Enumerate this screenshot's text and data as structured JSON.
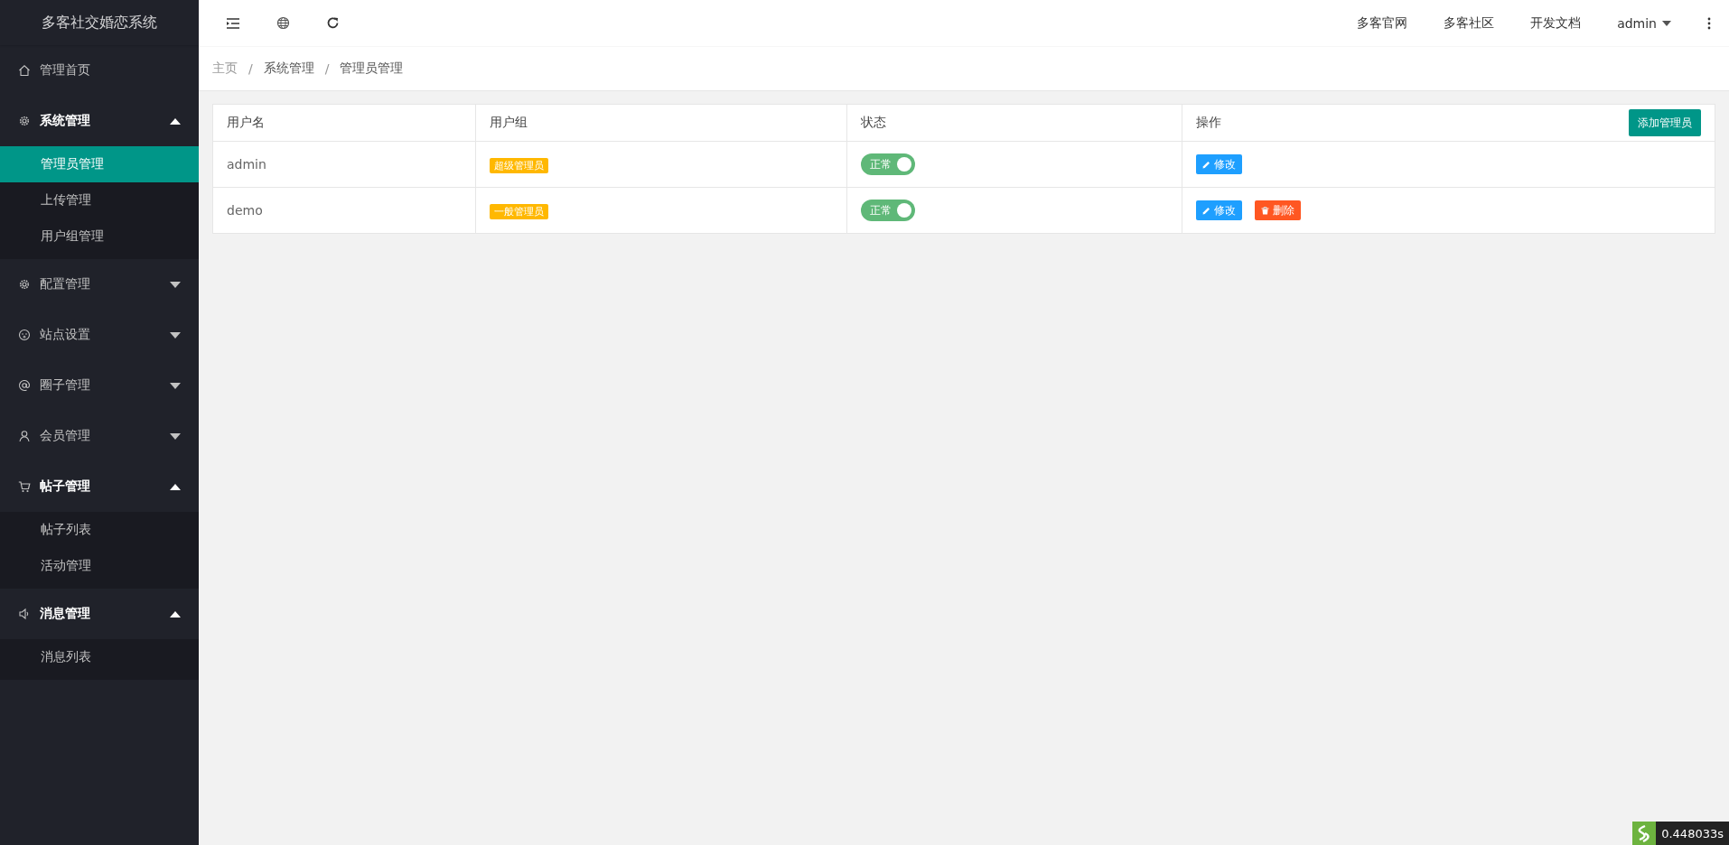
{
  "app_title": "多客社交婚恋系统",
  "sidebar": {
    "items": [
      {
        "label": "管理首页"
      },
      {
        "label": "系统管理",
        "expanded": true,
        "children": [
          {
            "label": "管理员管理",
            "selected": true
          },
          {
            "label": "上传管理",
            "selected": false
          },
          {
            "label": "用户组管理",
            "selected": false
          }
        ]
      },
      {
        "label": "配置管理",
        "expanded": false
      },
      {
        "label": "站点设置",
        "expanded": false
      },
      {
        "label": "圈子管理",
        "expanded": false
      },
      {
        "label": "会员管理",
        "expanded": false
      },
      {
        "label": "帖子管理",
        "expanded": true,
        "children": [
          {
            "label": "帖子列表",
            "selected": false
          },
          {
            "label": "活动管理",
            "selected": false
          }
        ]
      },
      {
        "label": "消息管理",
        "expanded": true,
        "children": [
          {
            "label": "消息列表",
            "selected": false
          }
        ]
      }
    ]
  },
  "topbar": {
    "links": [
      "多客官网",
      "多客社区",
      "开发文档"
    ],
    "user": "admin"
  },
  "breadcrumb": {
    "separator": "/",
    "items": [
      "主页",
      "系统管理",
      "管理员管理"
    ]
  },
  "table": {
    "columns": [
      "用户名",
      "用户组",
      "状态",
      "操作"
    ],
    "add_button": "添加管理员",
    "rows": [
      {
        "username": "admin",
        "group": "超级管理员",
        "status": {
          "label": "正常",
          "on": true
        },
        "actions": [
          {
            "kind": "edit",
            "label": "修改"
          }
        ]
      },
      {
        "username": "demo",
        "group": "一般管理员",
        "status": {
          "label": "正常",
          "on": true
        },
        "actions": [
          {
            "kind": "edit",
            "label": "修改"
          },
          {
            "kind": "delete",
            "label": "删除"
          }
        ]
      }
    ]
  },
  "trace": "0.448033s"
}
